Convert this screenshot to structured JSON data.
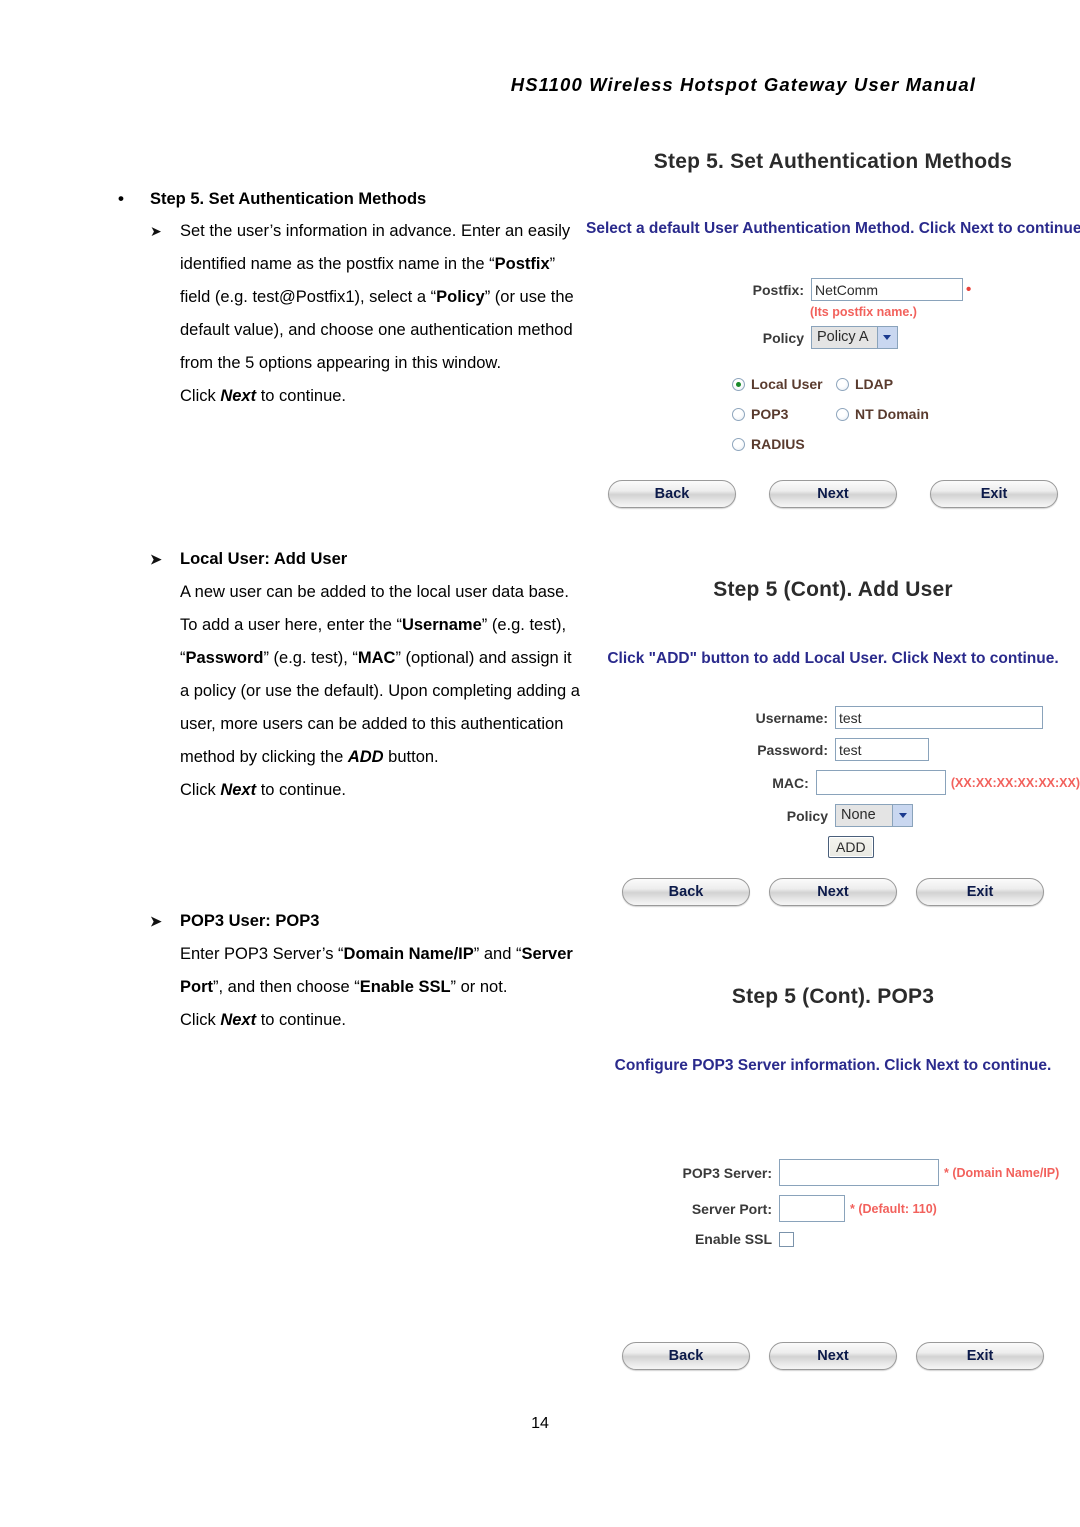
{
  "document": {
    "header_title": "HS1100 Wireless Hotspot Gateway User Manual",
    "page_number": "14"
  },
  "body_sections": [
    {
      "bullet_heading": "Step 5. Set Authentication Methods",
      "arrow_paragraphs": [
        "Set the user’s information in advance. Enter an easily identified name as the postfix name in the “Postfix” field (e.g. test@Postfix1), select a “Policy” (or use the default value), and choose one authentication method from the 5 options appearing in this window.",
        "Click Next to continue."
      ]
    },
    {
      "arrow_heading": "Local User: Add User",
      "paragraphs": [
        "A new user can be added to the local user data base. To add a user here, enter the “Username” (e.g. test), “Password” (e.g. test), “MAC” (optional) and assign it a policy (or use the default). Upon completing adding a user, more users can be added to this authentication method by clicking the ADD button.",
        "Click Next to continue."
      ]
    },
    {
      "arrow_heading": "POP3 User: POP3",
      "paragraphs": [
        "Enter POP3 Server’s “Domain Name/IP” and “Server Port”, and then choose “Enable SSL” or not.",
        "Click Next to continue."
      ]
    }
  ],
  "screens": {
    "auth_methods": {
      "title": "Step 5. Set Authentication Methods",
      "instruction": "Select a default User Authentication Method. Click Next to continue.",
      "fields": {
        "postfix_label": "Postfix:",
        "postfix_value": "NetComm",
        "postfix_required_mark": "•",
        "postfix_hint": "(Its postfix name.)",
        "policy_label": "Policy",
        "policy_value": "Policy A"
      },
      "auth_options": [
        {
          "label": "Local User",
          "selected": true
        },
        {
          "label": "LDAP",
          "selected": false
        },
        {
          "label": "POP3",
          "selected": false
        },
        {
          "label": "NT Domain",
          "selected": false
        },
        {
          "label": "RADIUS",
          "selected": false
        }
      ],
      "buttons": {
        "back": "Back",
        "next": "Next",
        "exit": "Exit"
      }
    },
    "add_user": {
      "title": "Step 5 (Cont). Add User",
      "instruction": "Click \"ADD\" button to add Local User. Click Next to continue.",
      "fields": {
        "username_label": "Username:",
        "username_value": "test",
        "password_label": "Password:",
        "password_value": "test",
        "mac_label": "MAC:",
        "mac_value": "",
        "mac_hint": "(XX:XX:XX:XX:XX:XX)",
        "policy_label": "Policy",
        "policy_value": "None",
        "add_label": "ADD"
      },
      "buttons": {
        "back": "Back",
        "next": "Next",
        "exit": "Exit"
      }
    },
    "pop3": {
      "title": "Step 5 (Cont). POP3",
      "instruction": "Configure POP3 Server information. Click Next to continue.",
      "fields": {
        "server_label": "POP3 Server:",
        "server_value": "",
        "server_hint": "* (Domain Name/IP)",
        "port_label": "Server Port:",
        "port_value": "",
        "port_hint": "* (Default: 110)",
        "ssl_label": "Enable SSL",
        "ssl_checked": false
      },
      "buttons": {
        "back": "Back",
        "next": "Next",
        "exit": "Exit"
      }
    }
  },
  "colors": {
    "instruction_blue": "#2a2a8c",
    "hint_red": "#f2615c",
    "radio_label_brown": "#5a3b2e",
    "button_text_navy": "#0c1a4a",
    "radio_selected_green": "#1a8a2a"
  }
}
